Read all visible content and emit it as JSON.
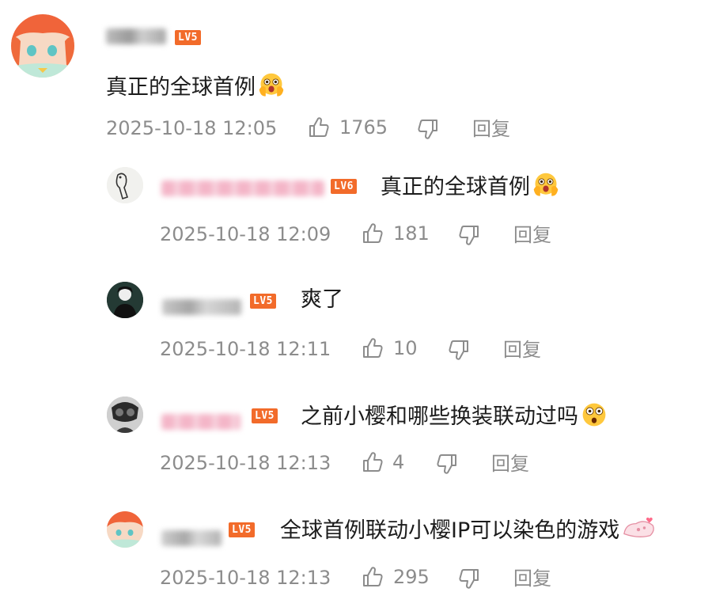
{
  "badges": {
    "lv5": "LV5",
    "lv6": "LV6"
  },
  "comments": [
    {
      "level": "LV5",
      "content": "真正的全球首例",
      "emoji": "astonished-face-hands-emoji",
      "time": "2025-10-18 12:05",
      "likes": "1765",
      "reply": "回复"
    },
    {
      "level": "LV6",
      "content": "真正的全球首例",
      "emoji": "astonished-face-hands-emoji",
      "time": "2025-10-18 12:09",
      "likes": "181",
      "reply": "回复"
    },
    {
      "level": "LV5",
      "content": "爽了",
      "time": "2025-10-18 12:11",
      "likes": "10",
      "reply": "回复"
    },
    {
      "level": "LV5",
      "content": "之前小樱和哪些换装联动过吗",
      "emoji": "surprised-face-emoji",
      "time": "2025-10-18 12:13",
      "likes": "4",
      "reply": "回复"
    },
    {
      "level": "LV5",
      "content": "全球首例联动小樱IP可以染色的游戏",
      "emoji": "cat-paw-sticker",
      "time": "2025-10-18 12:13",
      "likes": "295",
      "reply": "回复"
    }
  ],
  "icons": {
    "like": "thumbs-up-icon",
    "dislike": "thumbs-down-icon"
  }
}
